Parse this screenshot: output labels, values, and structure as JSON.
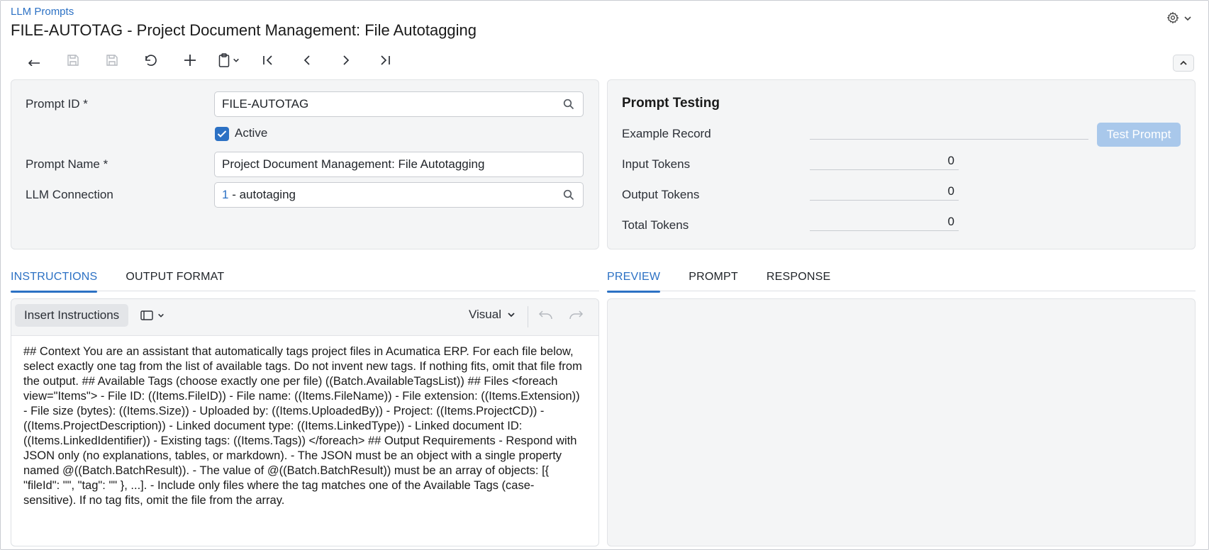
{
  "header": {
    "breadcrumb": "LLM Prompts",
    "title": "FILE-AUTOTAG - Project Document Management: File Autotagging"
  },
  "icons": {
    "settings": "gear-icon",
    "toolbar": [
      "back-arrow-icon",
      "save-close-icon",
      "save-icon",
      "undo-icon",
      "plus-icon",
      "clipboard-icon",
      "first-record-icon",
      "previous-icon",
      "next-icon",
      "last-record-icon"
    ]
  },
  "form": {
    "prompt_id_label": "Prompt ID *",
    "prompt_id_value": "FILE-AUTOTAG",
    "active_label": "Active",
    "active_checked": true,
    "prompt_name_label": "Prompt Name *",
    "prompt_name_value": "Project Document Management: File Autotagging",
    "llm_connection_label": "LLM Connection",
    "llm_connection_id": "1",
    "llm_connection_name": " - autotaging"
  },
  "testing": {
    "title": "Prompt Testing",
    "example_record_label": "Example Record",
    "example_record_value": "",
    "test_button": "Test Prompt",
    "input_tokens_label": "Input Tokens",
    "input_tokens_value": "0",
    "output_tokens_label": "Output Tokens",
    "output_tokens_value": "0",
    "total_tokens_label": "Total Tokens",
    "total_tokens_value": "0"
  },
  "left_tabs": [
    "INSTRUCTIONS",
    "OUTPUT FORMAT"
  ],
  "right_tabs": [
    "PREVIEW",
    "PROMPT",
    "RESPONSE"
  ],
  "editor": {
    "insert_button": "Insert Instructions",
    "mode": "Visual",
    "content": "## Context You are an assistant that automatically tags project files in Acumatica ERP. For each file below, select exactly one tag from the list of available tags. Do not invent new tags. If nothing fits, omit that file from the output. ## Available Tags (choose exactly one per file) ((Batch.AvailableTagsList)) ## Files <foreach view=\"Items\"> - File ID: ((Items.FileID)) - File name: ((Items.FileName)) - File extension: ((Items.Extension)) - File size (bytes): ((Items.Size)) - Uploaded by: ((Items.UploadedBy)) - Project: ((Items.ProjectCD)) - ((Items.ProjectDescription)) - Linked document type: ((Items.LinkedType)) - Linked document ID: ((Items.LinkedIdentifier)) - Existing tags: ((Items.Tags)) </foreach> ## Output Requirements - Respond with JSON only (no explanations, tables, or markdown). - The JSON must be an object with a single property named @((Batch.BatchResult)). - The value of @((Batch.BatchResult)) must be an array of objects: [{ \"fileId\": \"\", \"tag\": \"\" }, ...]. - Include only files where the tag matches one of the Available Tags (case-sensitive). If no tag fits, omit the file from the array."
  },
  "colors": {
    "accent": "#2c71c4",
    "panel": "#f4f5f6",
    "disabled_button": "#a9c8eb"
  }
}
